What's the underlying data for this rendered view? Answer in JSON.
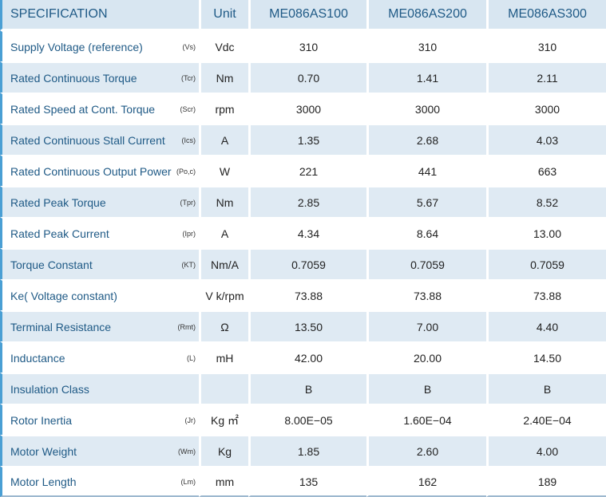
{
  "header": {
    "spec": "SPECIFICATION",
    "unit": "Unit",
    "models": [
      "ME086AS100",
      "ME086AS200",
      "ME086AS300"
    ]
  },
  "rows": [
    {
      "name": "Supply Voltage (reference)",
      "symbol": "(Vs)",
      "unit": "Vdc",
      "values": [
        "310",
        "310",
        "310"
      ]
    },
    {
      "name": "Rated Continuous Torque",
      "symbol": "(Tcr)",
      "unit": "Nm",
      "values": [
        "0.70",
        "1.41",
        "2.11"
      ]
    },
    {
      "name": "Rated Speed at Cont. Torque",
      "symbol": "(Scr)",
      "unit": "rpm",
      "values": [
        "3000",
        "3000",
        "3000"
      ]
    },
    {
      "name": "Rated Continuous Stall Current",
      "symbol": "(Ics)",
      "unit": "A",
      "values": [
        "1.35",
        "2.68",
        "4.03"
      ]
    },
    {
      "name": "Rated Continuous Output Power",
      "symbol": "(Po,c)",
      "unit": "W",
      "values": [
        "221",
        "441",
        "663"
      ]
    },
    {
      "name": "Rated Peak Torque",
      "symbol": "(Tpr)",
      "unit": "Nm",
      "values": [
        "2.85",
        "5.67",
        "8.52"
      ]
    },
    {
      "name": "Rated Peak Current",
      "symbol": "(Ipr)",
      "unit": "A",
      "values": [
        "4.34",
        "8.64",
        "13.00"
      ]
    },
    {
      "name": "Torque Constant",
      "symbol": "(KT)",
      "unit": "Nm/A",
      "values": [
        "0.7059",
        "0.7059",
        "0.7059"
      ]
    },
    {
      "name": "Ke( Voltage constant)",
      "symbol": "",
      "unit": "V k/rpm",
      "values": [
        "73.88",
        "73.88",
        "73.88"
      ]
    },
    {
      "name": "Terminal Resistance",
      "symbol": "(Rmt)",
      "unit": "Ω",
      "values": [
        "13.50",
        "7.00",
        "4.40"
      ]
    },
    {
      "name": "Inductance",
      "symbol": "(L)",
      "unit": "mH",
      "values": [
        "42.00",
        "20.00",
        "14.50"
      ]
    },
    {
      "name": "Insulation Class",
      "symbol": "",
      "unit": "",
      "values": [
        "B",
        "B",
        "B"
      ]
    },
    {
      "name": "Rotor Inertia",
      "symbol": "(Jr)",
      "unit": "Kg ㎡",
      "values": [
        "8.00E−05",
        "1.60E−04",
        "2.40E−04"
      ]
    },
    {
      "name": "Motor Weight",
      "symbol": "(Wm)",
      "unit": "Kg",
      "values": [
        "1.85",
        "2.60",
        "4.00"
      ]
    },
    {
      "name": "Motor Length",
      "symbol": "(Lm)",
      "unit": "mm",
      "values": [
        "135",
        "162",
        "189"
      ]
    }
  ]
}
